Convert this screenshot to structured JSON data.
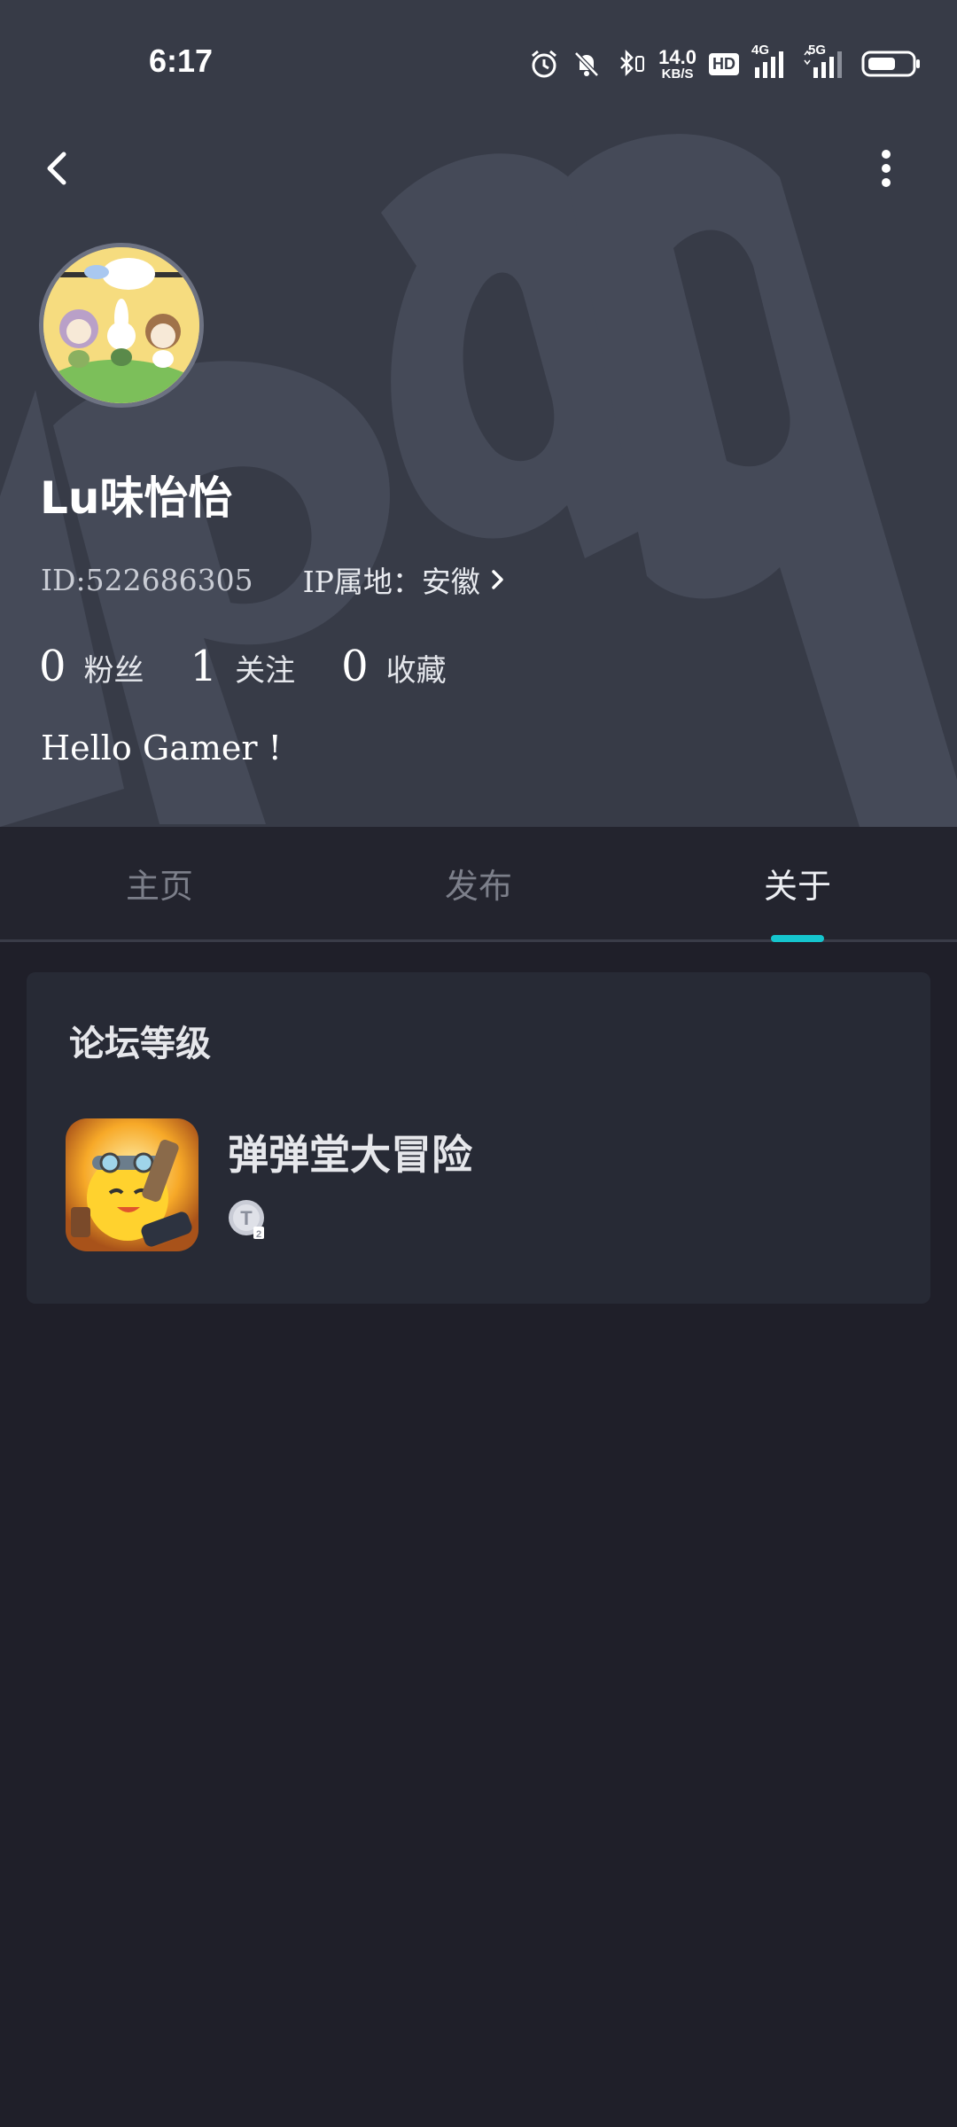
{
  "status_bar": {
    "time": "6:17",
    "net_speed_value": "14.0",
    "net_speed_unit": "KB/S",
    "hd_label": "HD",
    "signal_4g": "4G",
    "signal_5g": "5G"
  },
  "profile": {
    "username": "Lu味怡怡",
    "id_text": "ID:522686305",
    "ip_text": "IP属地：安徽",
    "bio": "Hello Gamer !",
    "stats": [
      {
        "count": "0",
        "label": "粉丝"
      },
      {
        "count": "1",
        "label": "关注"
      },
      {
        "count": "0",
        "label": "收藏"
      }
    ]
  },
  "tabs": [
    {
      "label": "主页",
      "active": false
    },
    {
      "label": "发布",
      "active": false
    },
    {
      "label": "关于",
      "active": true
    }
  ],
  "forum_level": {
    "title": "论坛等级",
    "games": [
      {
        "name": "弹弹堂大冒险",
        "badge": "T"
      }
    ]
  },
  "colors": {
    "accent": "#15c5ce",
    "header_bg": "#373b47",
    "page_bg": "#1f1f29",
    "card_bg": "#272a35"
  }
}
